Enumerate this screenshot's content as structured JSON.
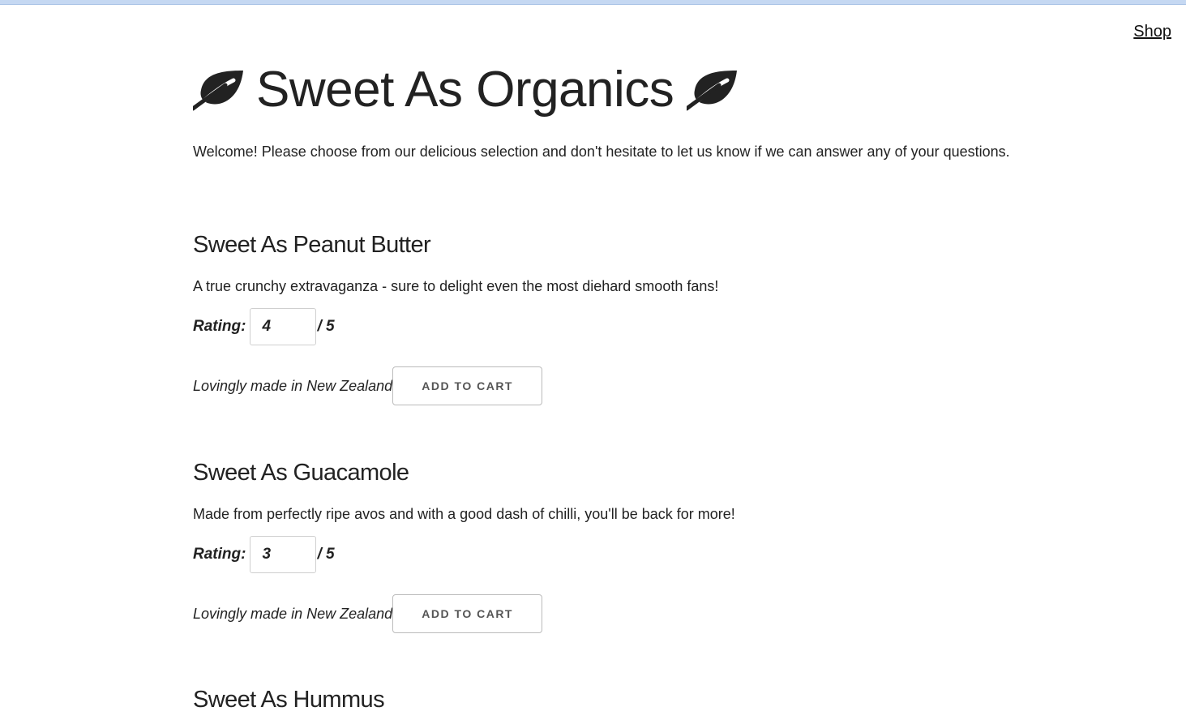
{
  "nav": {
    "shop_label": "Shop"
  },
  "header": {
    "title": "Sweet As Organics",
    "icon": "leaf-icon",
    "welcome": "Welcome! Please choose from our delicious selection and don't hesitate to let us know if we can answer any of your questions."
  },
  "products": [
    {
      "name": "Sweet As Peanut Butter",
      "description": "A true crunchy extravaganza - sure to delight even the most diehard smooth fans!",
      "rating_label": "Rating:",
      "rating_value": "4",
      "rating_max": "/ 5",
      "origin": "Lovingly made in New Zealand",
      "button_label": "ADD TO CART"
    },
    {
      "name": "Sweet As Guacamole",
      "description": "Made from perfectly ripe avos and with a good dash of chilli, you'll be back for more!",
      "rating_label": "Rating:",
      "rating_value": "3",
      "rating_max": "/ 5",
      "origin": "Lovingly made in New Zealand",
      "button_label": "ADD TO CART"
    },
    {
      "name": "Sweet As Hummus"
    }
  ],
  "colors": {
    "text": "#222222",
    "top_strip": "#c5d8f2",
    "button_text": "#555555",
    "border": "#cfcfcf"
  }
}
